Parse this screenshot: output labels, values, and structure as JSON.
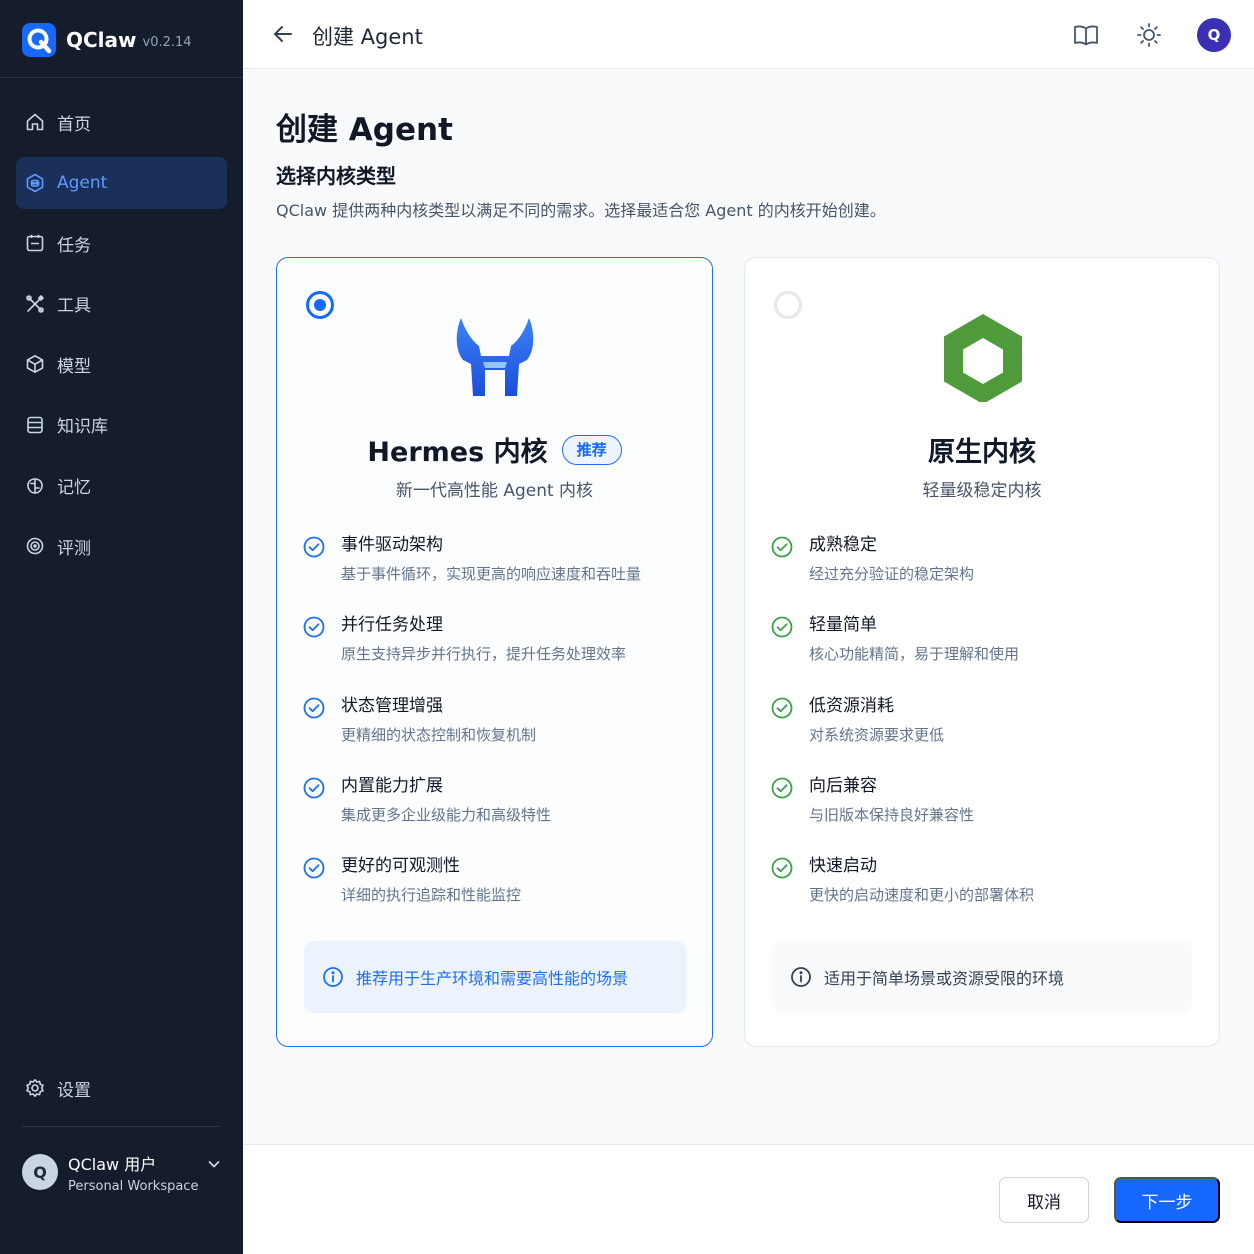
{
  "app": {
    "name": "QClaw",
    "version": "v0.2.14"
  },
  "sidebar": {
    "items": [
      {
        "label": "首页",
        "icon": "home-icon"
      },
      {
        "label": "Agent",
        "icon": "agent-icon",
        "active": true
      },
      {
        "label": "任务",
        "icon": "task-icon"
      },
      {
        "label": "工具",
        "icon": "tools-icon"
      },
      {
        "label": "模型",
        "icon": "model-icon"
      },
      {
        "label": "知识库",
        "icon": "database-icon"
      },
      {
        "label": "记忆",
        "icon": "memory-icon"
      },
      {
        "label": "评测",
        "icon": "evaluation-icon"
      }
    ],
    "settings": {
      "label": "设置",
      "icon": "gear-icon"
    },
    "user": {
      "avatar": "Q",
      "name": "QClaw 用户",
      "workspace": "Personal Workspace"
    }
  },
  "topbar": {
    "title": "创建 Agent",
    "avatar": "Q"
  },
  "page": {
    "title": "创建 Agent",
    "subtitle": "选择内核类型",
    "description": "QClaw 提供两种内核类型以满足不同的需求。选择最适合您 Agent 的内核开始创建。"
  },
  "cards": [
    {
      "title": "Hermes 内核",
      "badge": "推荐",
      "subtitle": "新一代高性能 Agent 内核",
      "selected": true,
      "features": [
        {
          "title": "事件驱动架构",
          "desc": "基于事件循环，实现更高的响应速度和吞吐量"
        },
        {
          "title": "并行任务处理",
          "desc": "原生支持异步并行执行，提升任务处理效率"
        },
        {
          "title": "状态管理增强",
          "desc": "更精细的状态控制和恢复机制"
        },
        {
          "title": "内置能力扩展",
          "desc": "集成更多企业级能力和高级特性"
        },
        {
          "title": "更好的可观测性",
          "desc": "详细的执行追踪和性能监控"
        }
      ],
      "note": "推荐用于生产环境和需要高性能的场景"
    },
    {
      "title": "原生内核",
      "subtitle": "轻量级稳定内核",
      "selected": false,
      "features": [
        {
          "title": "成熟稳定",
          "desc": "经过充分验证的稳定架构"
        },
        {
          "title": "轻量简单",
          "desc": "核心功能精简，易于理解和使用"
        },
        {
          "title": "低资源消耗",
          "desc": "对系统资源要求更低"
        },
        {
          "title": "向后兼容",
          "desc": "与旧版本保持良好兼容性"
        },
        {
          "title": "快速启动",
          "desc": "更快的启动速度和更小的部署体积"
        }
      ],
      "note": "适用于简单场景或资源受限的环境"
    }
  ],
  "footer": {
    "cancel": "取消",
    "next": "下一步"
  },
  "colors": {
    "primary": "#1668ff",
    "sidebar_bg": "#151d2c",
    "active_bg": "#1b3059",
    "green": "#3aa14a"
  }
}
